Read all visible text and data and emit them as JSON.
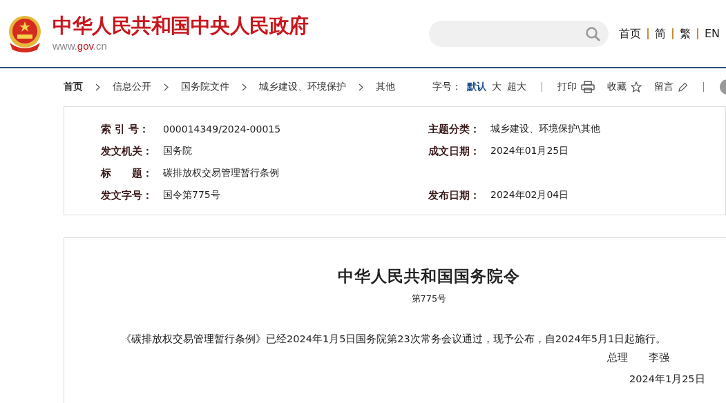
{
  "header": {
    "title": "中华人民共和国中央人民政府",
    "domain_parts": [
      {
        "text": "www.",
        "accent": false
      },
      {
        "text": "gov",
        "accent": true
      },
      {
        "text": ".cn",
        "accent": false
      }
    ]
  },
  "top_nav": [
    "首页",
    "简",
    "繁",
    "EN"
  ],
  "breadcrumb": [
    "首页",
    "信息公开",
    "国务院文件",
    "城乡建设、环境保护",
    "其他"
  ],
  "font_size": {
    "label": "字号：",
    "options": [
      {
        "label": "默认",
        "selected": true
      },
      {
        "label": "大",
        "selected": false
      },
      {
        "label": "超大",
        "selected": false
      }
    ]
  },
  "tools": [
    {
      "label": "打印",
      "kind": "print"
    },
    {
      "label": "收藏",
      "kind": "star"
    },
    {
      "label": "留言",
      "kind": "pencil"
    }
  ],
  "meta": [
    [
      {
        "label": "索 引 号：",
        "value": "000014349/2024-00015"
      },
      {
        "label": "主题分类：",
        "value": "城乡建设、环境保护\\其他"
      }
    ],
    [
      {
        "label": "发文机关：",
        "value": "国务院"
      },
      {
        "label": "成文日期：",
        "value": "2024年01月25日"
      }
    ],
    [
      {
        "label": "标　　题：",
        "value": "碳排放权交易管理暂行条例"
      }
    ],
    [
      {
        "label": "发文字号：",
        "value": "国令第775号"
      },
      {
        "label": "发布日期：",
        "value": "2024年02月04日"
      }
    ]
  ],
  "document": {
    "title": "中华人民共和国国务院令",
    "number": "第775号",
    "body": "《碳排放权交易管理暂行条例》已经2024年1月5日国务院第23次常务会议通过，现予公布，自2024年5月1日起施行。",
    "signature_title": "总理",
    "signer": "李强",
    "date": "2024年1月25日"
  }
}
